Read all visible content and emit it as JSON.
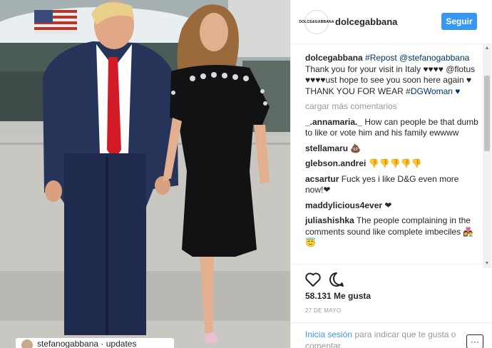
{
  "post": {
    "username": "dolcegabbana",
    "avatar_text": "DOLCE&GABBANA",
    "follow_label": "Seguir"
  },
  "photo": {
    "caption_user": "stefanogabbana",
    "caption_text": "stefanogabbana · updates"
  },
  "caption": {
    "username": "dolcegabbana",
    "parts": [
      "#Repost @stefanogabbana",
      "Thank you for your visit in Italy ♥♥♥♥",
      "@flotus ♥♥♥♥ust hope to see you soon here again ♥ THANK YOU FOR WEAR",
      "#DGWoman ♥"
    ]
  },
  "load_more": "cargar más comentarios",
  "comments": [
    {
      "user": "_.annamaria._",
      "text": "How can people be that dumb to like or vote him and his family ewwww"
    },
    {
      "user": "stellamaru",
      "text": "💩"
    },
    {
      "user": "glebson.andrei",
      "text": "👎👎👎👎👎"
    },
    {
      "user": "acsartur",
      "text": "Fuck yes i like D&G even more now!❤"
    },
    {
      "user": "maddylicious4ever",
      "text": "❤"
    },
    {
      "user": "juliashishka",
      "text": "The people complaining in the comments sound like complete imbeciles 👩‍❤️‍👨😇"
    }
  ],
  "likes_label": "58.131 Me gusta",
  "date": "27 DE MAYO",
  "login": {
    "link": "Inicia sesión",
    "rest": " para indicar que te gusta o comentar."
  },
  "options_label": "···",
  "icons": [
    "heart-icon",
    "comment-icon",
    "more-options-icon"
  ]
}
